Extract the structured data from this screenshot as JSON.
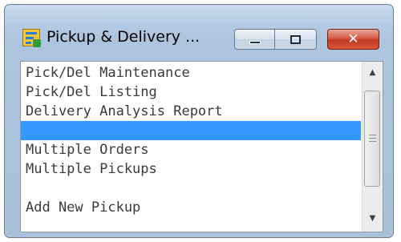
{
  "window": {
    "title": "Pickup & Delivery ...",
    "icon": "application-icon",
    "controls": {
      "minimize": "minimize-icon",
      "maximize": "maximize-icon",
      "close": "✕"
    },
    "colors": {
      "frame": "#adc4de",
      "close_button": "#c23a22",
      "selection": "#3399ff"
    }
  },
  "menu": {
    "items": [
      {
        "label": "Pick/Del Maintenance"
      },
      {
        "label": "Pick/Del Listing"
      },
      {
        "label": "Delivery Analysis Report"
      },
      {
        "label": "",
        "selected": true
      },
      {
        "label": "Multiple Orders"
      },
      {
        "label": "Multiple Pickups"
      },
      {
        "label": ""
      },
      {
        "label": "Add New Pickup"
      }
    ]
  },
  "scrollbar": {
    "up_arrow": "▲",
    "down_arrow": "▼"
  }
}
